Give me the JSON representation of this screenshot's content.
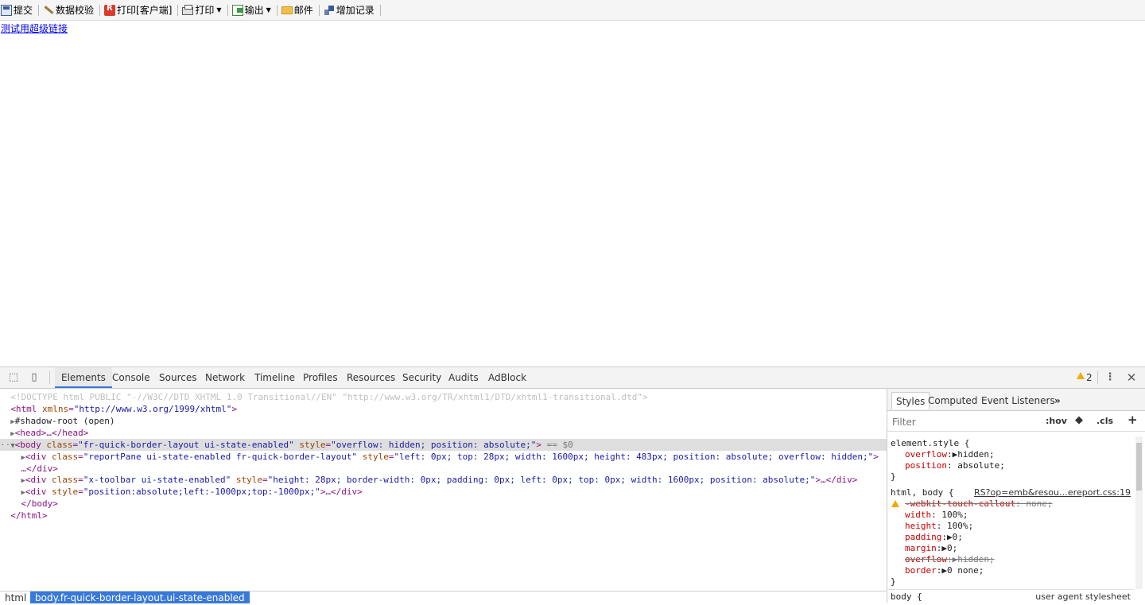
{
  "toolbar": {
    "items": [
      {
        "label": "提交",
        "icon": "submit-icon"
      },
      {
        "label": "数据校验",
        "icon": "verify-icon"
      },
      {
        "label": "打印[客户端]",
        "icon": "print-client-icon"
      },
      {
        "label": "打印",
        "icon": "print-icon"
      },
      {
        "label": "输出",
        "icon": "export-icon"
      },
      {
        "label": "邮件",
        "icon": "mail-icon"
      },
      {
        "label": "增加记录",
        "icon": "add-record-icon"
      }
    ]
  },
  "page": {
    "link_text": "测试用超级链接"
  },
  "devtools": {
    "tabs": [
      "Elements",
      "Console",
      "Sources",
      "Network",
      "Timeline",
      "Profiles",
      "Resources",
      "Security",
      "Audits",
      "AdBlock"
    ],
    "active_tab": "Elements",
    "warning_count": "2",
    "dom": {
      "doctype": "<!DOCTYPE html PUBLIC \"-//W3C//DTD XHTML 1.0 Transitional//EN\" \"http://www.w3.org/TR/xhtml1/DTD/xhtml1-transitional.dtd\">",
      "html_open_tag": "<html",
      "html_xmlns_attr": "xmlns",
      "html_xmlns_val": "\"http://www.w3.org/1999/xhtml\"",
      "shadow_root": "#shadow-root (open)",
      "head_collapsed": "<head>…</head>",
      "body_tag": "<body",
      "body_class_attr": "class",
      "body_class_val": "\"fr-quick-border-layout ui-state-enabled\"",
      "body_style_attr": "style",
      "body_style_val": "\"overflow: hidden; position: absolute;\"",
      "body_eq": "== $0",
      "div1_class_val": "\"reportPane ui-state-enabled fr-quick-border-layout\"",
      "div1_style_val": "\"left: 0px; top: 28px; width: 1600px; height: 483px; position: absolute; overflow: hidden;\"",
      "div1_close": "…</div>",
      "div2_class_val": "\"x-toolbar ui-state-enabled\"",
      "div2_style_val": "\"height: 28px; border-width: 0px; padding: 0px; left: 0px; top: 0px; width: 1600px; position: absolute;\"",
      "div3_style_val": "\"position:absolute;left:-1000px;top:-1000px;\"",
      "body_close": "</body>",
      "html_close": "</html>"
    },
    "breadcrumbs": [
      "html",
      "body.fr-quick-border-layout.ui-state-enabled"
    ],
    "styles": {
      "tabs": [
        "Styles",
        "Computed",
        "Event Listeners"
      ],
      "filter_placeholder": "Filter",
      "hov": ":hov",
      "cls": ".cls",
      "element_style_selector": "element.style {",
      "element_style_props": [
        {
          "name": "overflow",
          "value": "hidden;"
        },
        {
          "name": "position",
          "value": "absolute;"
        }
      ],
      "rule2_selector": "html, body {",
      "rule2_source": "RS?op=emb&resou…ereport.css:19",
      "rule2_props": [
        {
          "name": "-webkit-touch-callout",
          "value": "none;",
          "struck": true,
          "warning": true
        },
        {
          "name": "width",
          "value": "100%;"
        },
        {
          "name": "height",
          "value": "100%;"
        },
        {
          "name": "padding",
          "value": "0;"
        },
        {
          "name": "margin",
          "value": "0;"
        },
        {
          "name": "overflow",
          "value": "hidden;",
          "struck": true
        },
        {
          "name": "border",
          "value": "0 none;"
        }
      ],
      "rule3_selector": "body {",
      "rule3_source": "user agent stylesheet"
    }
  }
}
